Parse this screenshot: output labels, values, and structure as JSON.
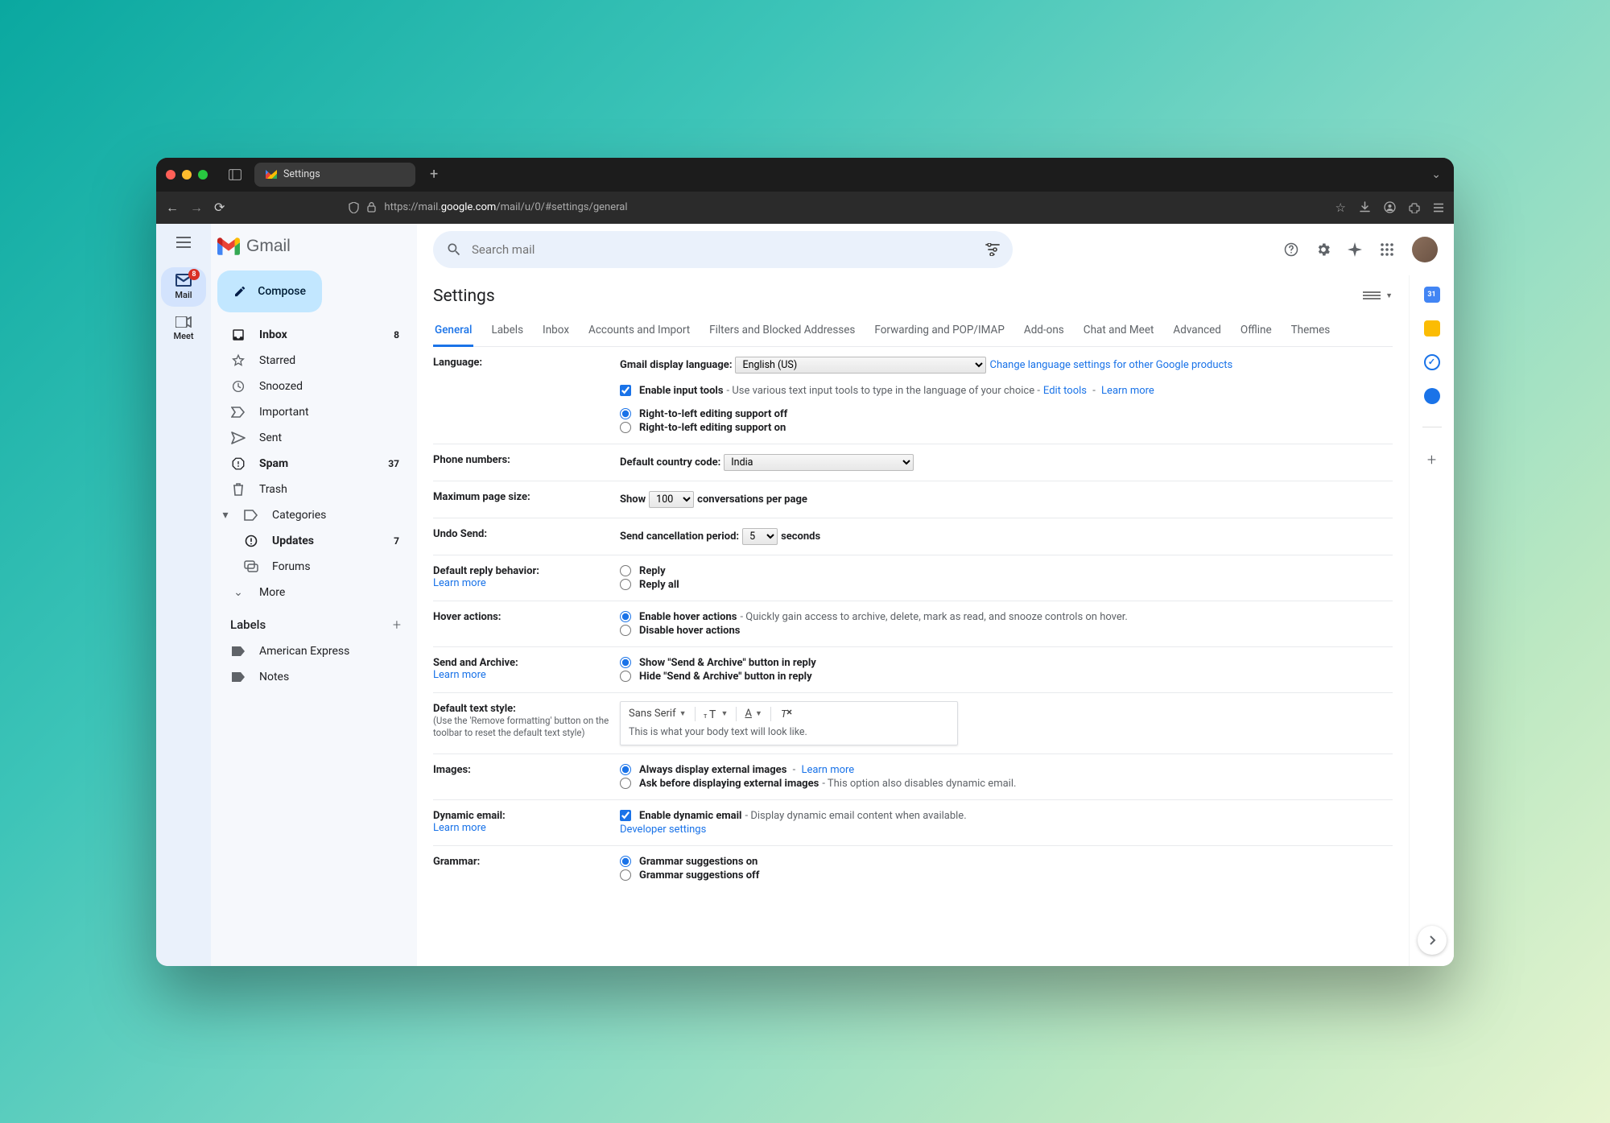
{
  "browser": {
    "tab_title": "Settings",
    "url_prefix": "https://mail.",
    "url_domain": "google.com",
    "url_path": "/mail/u/0/#settings/general"
  },
  "brand": {
    "name": "Gmail"
  },
  "rail": {
    "mail_label": "Mail",
    "mail_badge": "8",
    "meet_label": "Meet"
  },
  "compose_label": "Compose",
  "nav": {
    "inbox": "Inbox",
    "inbox_count": "8",
    "starred": "Starred",
    "snoozed": "Snoozed",
    "important": "Important",
    "sent": "Sent",
    "spam": "Spam",
    "spam_count": "37",
    "trash": "Trash",
    "categories": "Categories",
    "updates": "Updates",
    "updates_count": "7",
    "forums": "Forums",
    "more": "More"
  },
  "labels": {
    "header": "Labels",
    "items": [
      "American Express",
      "Notes"
    ]
  },
  "search": {
    "placeholder": "Search mail"
  },
  "title": "Settings",
  "tabs": [
    "General",
    "Labels",
    "Inbox",
    "Accounts and Import",
    "Filters and Blocked Addresses",
    "Forwarding and POP/IMAP",
    "Add-ons",
    "Chat and Meet",
    "Advanced",
    "Offline",
    "Themes"
  ],
  "settings": {
    "language": {
      "label": "Language:",
      "display_label": "Gmail display language:",
      "display_value": "English (US)",
      "change_link": "Change language settings for other Google products",
      "enable_tools": "Enable input tools",
      "enable_tools_hint": " - Use various text input tools to type in the language of your choice - ",
      "edit_tools": "Edit tools",
      "learn_more": "Learn more",
      "rtl_off": "Right-to-left editing support off",
      "rtl_on": "Right-to-left editing support on"
    },
    "phone": {
      "label": "Phone numbers:",
      "cc_label": "Default country code:",
      "cc_value": "India"
    },
    "page_size": {
      "label": "Maximum page size:",
      "show": "Show",
      "value": "100",
      "per_page": "conversations per page"
    },
    "undo": {
      "label": "Undo Send:",
      "period": "Send cancellation period:",
      "value": "5",
      "seconds": "seconds"
    },
    "reply": {
      "label": "Default reply behavior:",
      "learn_more": "Learn more",
      "reply": "Reply",
      "reply_all": "Reply all"
    },
    "hover": {
      "label": "Hover actions:",
      "enable": "Enable hover actions",
      "enable_hint": " - Quickly gain access to archive, delete, mark as read, and snooze controls on hover.",
      "disable": "Disable hover actions"
    },
    "send_archive": {
      "label": "Send and Archive:",
      "learn_more": "Learn more",
      "show": "Show \"Send & Archive\" button in reply",
      "hide": "Hide \"Send & Archive\" button in reply"
    },
    "text_style": {
      "label": "Default text style:",
      "sub": "(Use the 'Remove formatting' button on the toolbar to reset the default text style)",
      "font": "Sans Serif",
      "preview": "This is what your body text will look like."
    },
    "images": {
      "label": "Images:",
      "always": "Always display external images",
      "learn_more": "Learn more",
      "ask": "Ask before displaying external images",
      "ask_hint": " - This option also disables dynamic email."
    },
    "dynamic": {
      "label": "Dynamic email:",
      "learn_more": "Learn more",
      "enable": "Enable dynamic email",
      "hint": " - Display dynamic email content when available.",
      "dev": "Developer settings"
    },
    "grammar": {
      "label": "Grammar:",
      "on": "Grammar suggestions on",
      "off": "Grammar suggestions off"
    }
  }
}
